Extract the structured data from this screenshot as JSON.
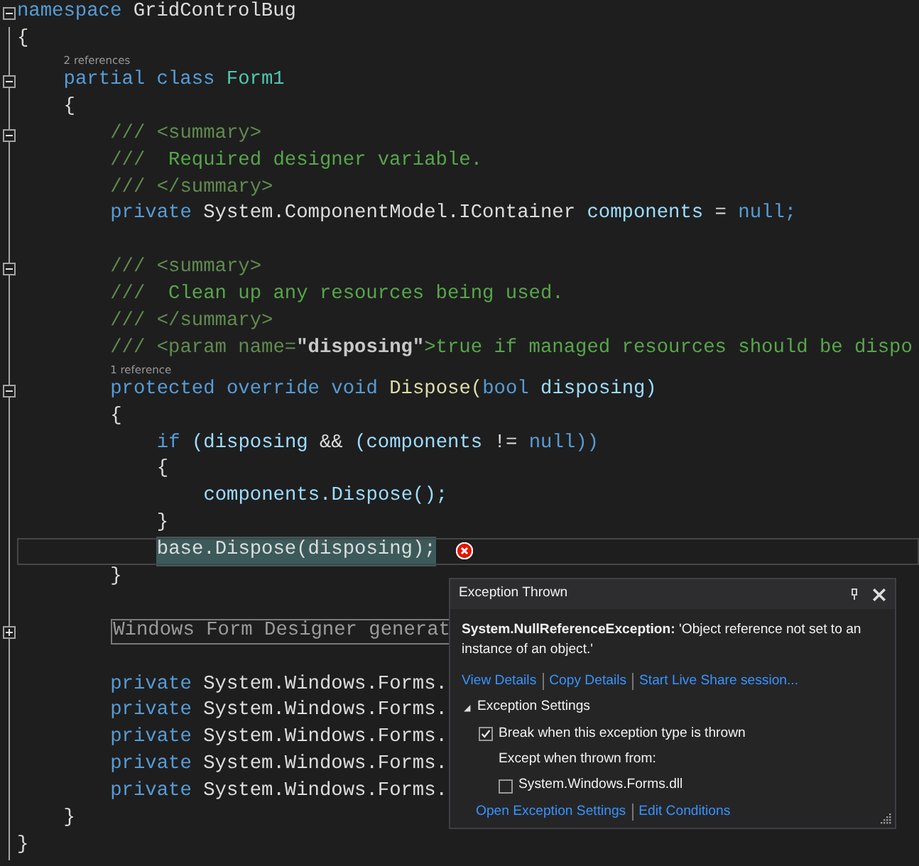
{
  "editor": {
    "lines": [
      {
        "kind": "code",
        "collapsed": false,
        "tokens": [
          {
            "t": "namespace",
            "kind": "kw"
          },
          {
            "t": "GridControlBug",
            "kind": "plain"
          }
        ]
      },
      {
        "kind": "code",
        "tokens": [
          {
            "t": "{",
            "kind": "plain"
          }
        ]
      },
      {
        "kind": "block",
        "children": [
          {
            "kind": "lens",
            "text": "2 references"
          },
          {
            "kind": "code",
            "collapsed": false,
            "tokens": [
              {
                "t": "partial",
                "kind": "kw"
              },
              {
                "t": "class",
                "kind": "kw"
              },
              {
                "t": "Form1",
                "kind": "type"
              }
            ]
          },
          {
            "kind": "code",
            "tokens": [
              {
                "t": "{",
                "kind": "plain"
              }
            ]
          },
          {
            "kind": "block",
            "children": [
              {
                "kind": "code",
                "collapsed": false,
                "tokens": [
                  {
                    "t": "///",
                    "kind": "doc"
                  },
                  {
                    "t": "<summary>",
                    "kind": "doc"
                  }
                ]
              },
              {
                "kind": "code",
                "tokens": [
                  {
                    "t": "///",
                    "kind": "doc"
                  },
                  {
                    "t": " Required designer variable.",
                    "kind": "comment"
                  }
                ]
              },
              {
                "kind": "code",
                "tokens": [
                  {
                    "t": "///",
                    "kind": "doc"
                  },
                  {
                    "t": "</summary>",
                    "kind": "doc"
                  }
                ]
              },
              {
                "kind": "code",
                "tokens": [
                  {
                    "t": "private",
                    "kind": "kw"
                  },
                  {
                    "t": "System.ComponentModel.IContainer",
                    "kind": "plain"
                  },
                  {
                    "t": "components",
                    "kind": "ident"
                  },
                  {
                    "t": "=",
                    "kind": "plain"
                  },
                  {
                    "t": "null;",
                    "kind": "kw"
                  }
                ]
              },
              {
                "kind": "blank"
              },
              {
                "kind": "code",
                "collapsed": false,
                "tokens": [
                  {
                    "t": "///",
                    "kind": "doc"
                  },
                  {
                    "t": "<summary>",
                    "kind": "doc"
                  }
                ]
              },
              {
                "kind": "code",
                "tokens": [
                  {
                    "t": "///",
                    "kind": "doc"
                  },
                  {
                    "t": " Clean up any resources being used.",
                    "kind": "comment"
                  }
                ]
              },
              {
                "kind": "code",
                "tokens": [
                  {
                    "t": "///",
                    "kind": "doc"
                  },
                  {
                    "t": "</summary>",
                    "kind": "doc"
                  }
                ]
              },
              {
                "kind": "code",
                "tokens": [
                  {
                    "t": "///",
                    "kind": "doc"
                  },
                  {
                    "t": "<param name=",
                    "kind": "doc"
                  },
                  {
                    "t": "\"disposing\"",
                    "kind": "param",
                    "joined": true
                  },
                  {
                    "t": ">true if managed resources should be dispo",
                    "kind": "comment",
                    "joined": true
                  }
                ]
              },
              {
                "kind": "lens",
                "text": "1 reference"
              },
              {
                "kind": "code",
                "collapsed": false,
                "tokens": [
                  {
                    "t": "protected",
                    "kind": "kw"
                  },
                  {
                    "t": "override",
                    "kind": "kw"
                  },
                  {
                    "t": "void",
                    "kind": "kw"
                  },
                  {
                    "t": "Dispose(",
                    "kind": "method"
                  },
                  {
                    "t": "bool",
                    "kind": "kw",
                    "joined": true
                  },
                  {
                    "t": "disposing)",
                    "kind": "ident"
                  }
                ]
              },
              {
                "kind": "code",
                "tokens": [
                  {
                    "t": "{",
                    "kind": "plain"
                  }
                ]
              },
              {
                "kind": "block",
                "children": [
                  {
                    "kind": "code",
                    "tokens": [
                      {
                        "t": "if",
                        "kind": "kw"
                      },
                      {
                        "t": "(disposing",
                        "kind": "ident"
                      },
                      {
                        "t": "&&",
                        "kind": "plain"
                      },
                      {
                        "t": "(components",
                        "kind": "ident"
                      },
                      {
                        "t": "!=",
                        "kind": "plain"
                      },
                      {
                        "t": "null))",
                        "kind": "kw"
                      }
                    ]
                  },
                  {
                    "kind": "code",
                    "tokens": [
                      {
                        "t": "{",
                        "kind": "plain"
                      }
                    ]
                  },
                  {
                    "kind": "block",
                    "children": [
                      {
                        "kind": "code",
                        "tokens": [
                          {
                            "t": "components.Dispose();",
                            "kind": "ident"
                          }
                        ]
                      }
                    ]
                  },
                  {
                    "kind": "code",
                    "tokens": [
                      {
                        "t": "}",
                        "kind": "plain"
                      }
                    ]
                  },
                  {
                    "kind": "code",
                    "current": true,
                    "error_marker": true,
                    "tokens": [
                      {
                        "t": "base.Dispose(disposing);",
                        "kind": "plain",
                        "selected": true
                      }
                    ]
                  }
                ]
              },
              {
                "kind": "code",
                "tokens": [
                  {
                    "t": "}",
                    "kind": "plain"
                  }
                ]
              },
              {
                "kind": "blank"
              },
              {
                "kind": "region",
                "collapsed": true,
                "text": "Windows Form Designer generat"
              },
              {
                "kind": "blank"
              },
              {
                "kind": "code",
                "tokens": [
                  {
                    "t": "private",
                    "kind": "kw"
                  },
                  {
                    "t": "System.Windows.Forms.",
                    "kind": "plain"
                  }
                ]
              },
              {
                "kind": "code",
                "tokens": [
                  {
                    "t": "private",
                    "kind": "kw"
                  },
                  {
                    "t": "System.Windows.Forms.",
                    "kind": "plain"
                  }
                ]
              },
              {
                "kind": "code",
                "tokens": [
                  {
                    "t": "private",
                    "kind": "kw"
                  },
                  {
                    "t": "System.Windows.Forms.",
                    "kind": "plain"
                  }
                ]
              },
              {
                "kind": "code",
                "tokens": [
                  {
                    "t": "private",
                    "kind": "kw"
                  },
                  {
                    "t": "System.Windows.Forms.",
                    "kind": "plain"
                  }
                ]
              },
              {
                "kind": "code",
                "tokens": [
                  {
                    "t": "private",
                    "kind": "kw"
                  },
                  {
                    "t": "System.Windows.Forms.",
                    "kind": "plain"
                  }
                ]
              }
            ]
          },
          {
            "kind": "code",
            "tokens": [
              {
                "t": "}",
                "kind": "plain"
              }
            ]
          }
        ]
      },
      {
        "kind": "code",
        "tokens": [
          {
            "t": "}",
            "kind": "plain"
          }
        ]
      }
    ]
  },
  "exception_popup": {
    "title": "Exception Thrown",
    "exception_type": "System.NullReferenceException:",
    "message": "'Object reference not set to an instance of an object.'",
    "links": [
      "View Details",
      "Copy Details",
      "Start Live Share session..."
    ],
    "settings_header": "Exception Settings",
    "settings_expanded": true,
    "break_option": {
      "label": "Break when this exception type is thrown",
      "checked": true
    },
    "except_label": "Except when thrown from:",
    "module_option": {
      "label": "System.Windows.Forms.dll",
      "checked": false
    },
    "footer_links": [
      "Open Exception Settings",
      "Edit Conditions"
    ]
  }
}
